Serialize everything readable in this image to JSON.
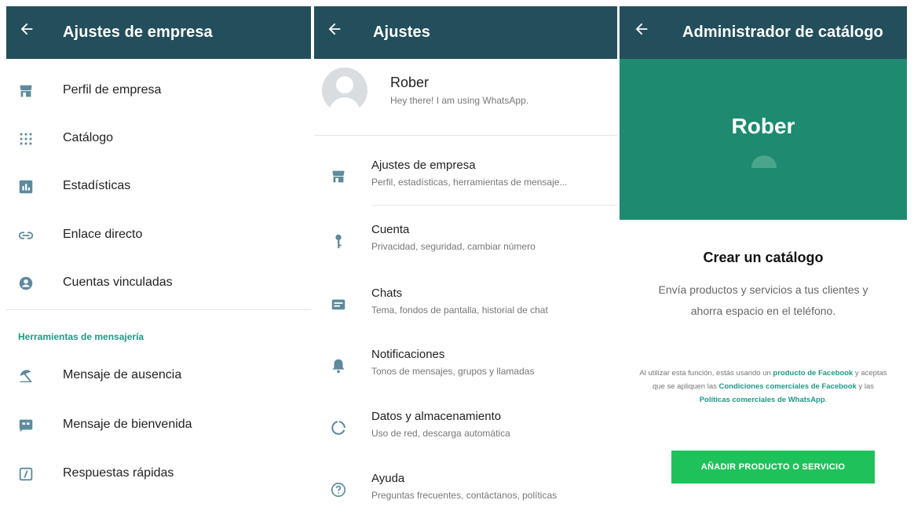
{
  "colors": {
    "appbar": "#234e5b",
    "accent": "#1d9a86",
    "banner": "#1e8a6f",
    "cta": "#1fc25a",
    "icon": "#5e8a9c"
  },
  "panel1": {
    "title": "Ajustes de empresa",
    "items": [
      {
        "label": "Perfil de empresa",
        "icon": "store-icon"
      },
      {
        "label": "Catálogo",
        "icon": "grid-icon"
      },
      {
        "label": "Estadísticas",
        "icon": "bar-chart-icon"
      },
      {
        "label": "Enlace directo",
        "icon": "link-icon"
      },
      {
        "label": "Cuentas vinculadas",
        "icon": "account-circle-icon"
      }
    ],
    "section_title": "Herramientas de mensajería",
    "tools": [
      {
        "label": "Mensaje de ausencia",
        "icon": "beach-umbrella-icon"
      },
      {
        "label": "Mensaje de bienvenida",
        "icon": "welcome-message-icon"
      },
      {
        "label": "Respuestas rápidas",
        "icon": "quick-reply-icon"
      }
    ]
  },
  "panel2": {
    "title": "Ajustes",
    "profile": {
      "name": "Rober",
      "status": "Hey there! I am using WhatsApp."
    },
    "items": [
      {
        "title": "Ajustes de empresa",
        "subtitle": "Perfil, estadísticas, herramientas de mensaje...",
        "icon": "store-icon"
      },
      {
        "title": "Cuenta",
        "subtitle": "Privacidad, seguridad, cambiar número",
        "icon": "key-icon"
      },
      {
        "title": "Chats",
        "subtitle": "Tema, fondos de pantalla, historial de chat",
        "icon": "chat-icon"
      },
      {
        "title": "Notificaciones",
        "subtitle": "Tonos de mensajes, grupos y llamadas",
        "icon": "bell-icon"
      },
      {
        "title": "Datos y almacenamiento",
        "subtitle": "Uso de red, descarga automática",
        "icon": "data-usage-icon"
      },
      {
        "title": "Ayuda",
        "subtitle": "Preguntas frecuentes, contáctanos, políticas",
        "icon": "help-icon"
      }
    ]
  },
  "panel3": {
    "title": "Administrador de catálogo",
    "banner_name": "Rober",
    "heading": "Crear un catálogo",
    "description_line1": "Envía productos y servicios a tus clientes y",
    "description_line2": "ahorra espacio en el teléfono.",
    "legal": {
      "p1": "Al utilizar esta función, estás usando un ",
      "l1": "producto de Facebook",
      "p2": " y aceptas que se apliquen las ",
      "l2": "Condiciones comerciales de Facebook",
      "p3": " y las ",
      "l3": "Políticas comerciales de WhatsApp",
      "p4": "."
    },
    "cta": "AÑADIR PRODUCTO O SERVICIO"
  }
}
